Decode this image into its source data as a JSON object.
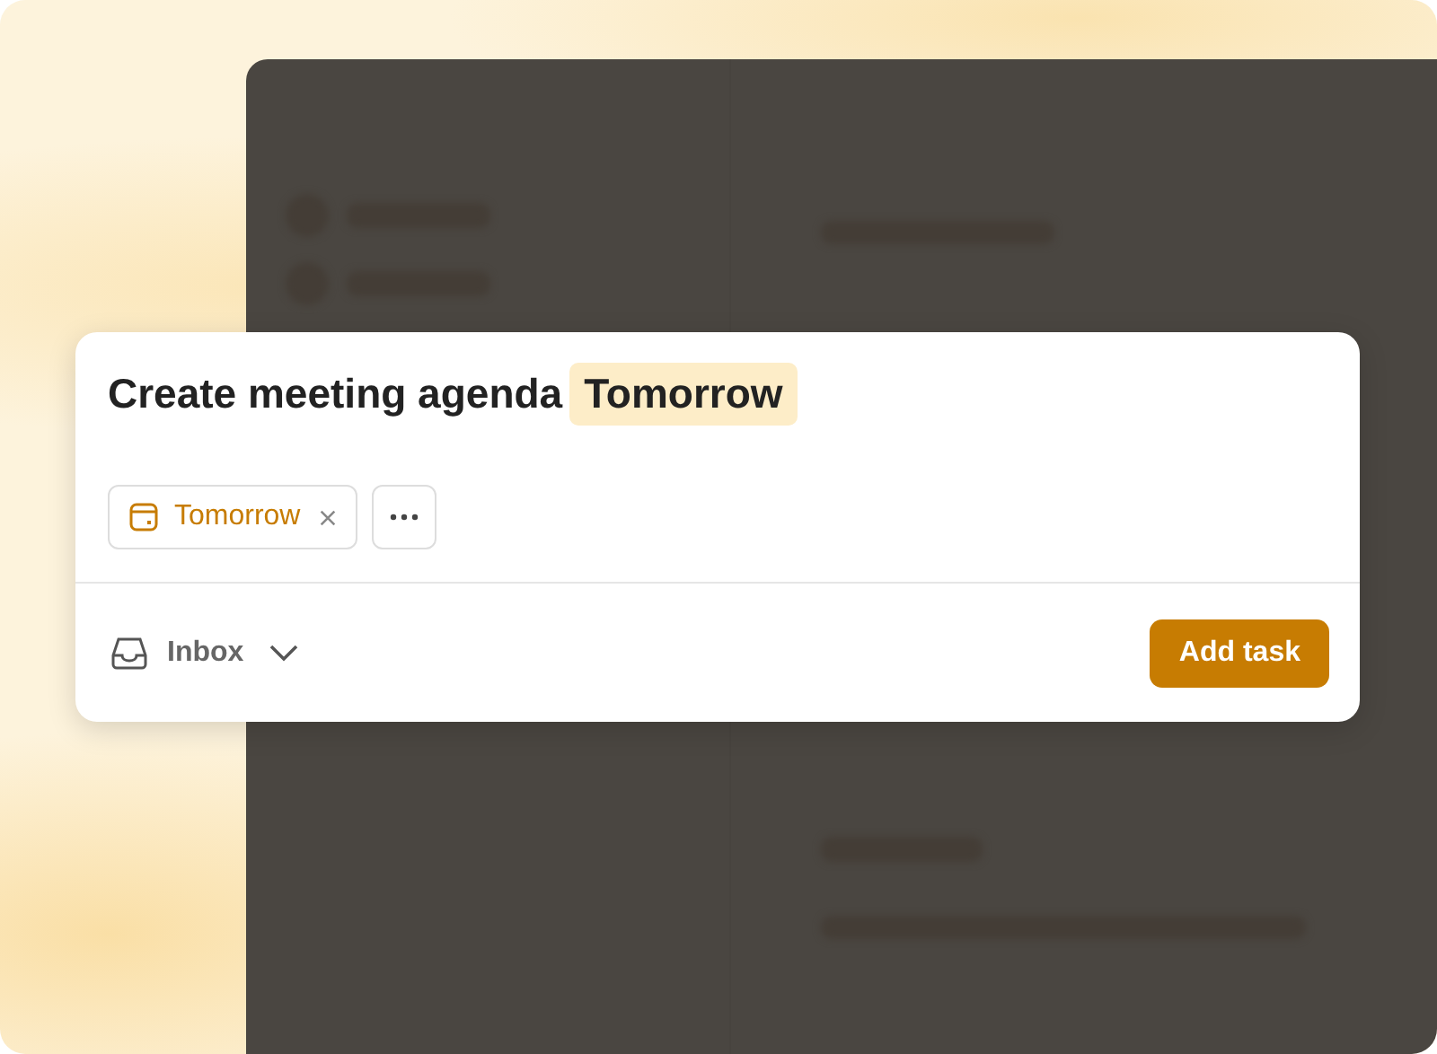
{
  "task_editor": {
    "task_name": "Create meeting agenda",
    "date_token": "Tomorrow",
    "chips": [
      {
        "kind": "date",
        "label": "Tomorrow"
      },
      {
        "kind": "more"
      }
    ],
    "project": "Inbox",
    "submit_button": "Add task"
  }
}
